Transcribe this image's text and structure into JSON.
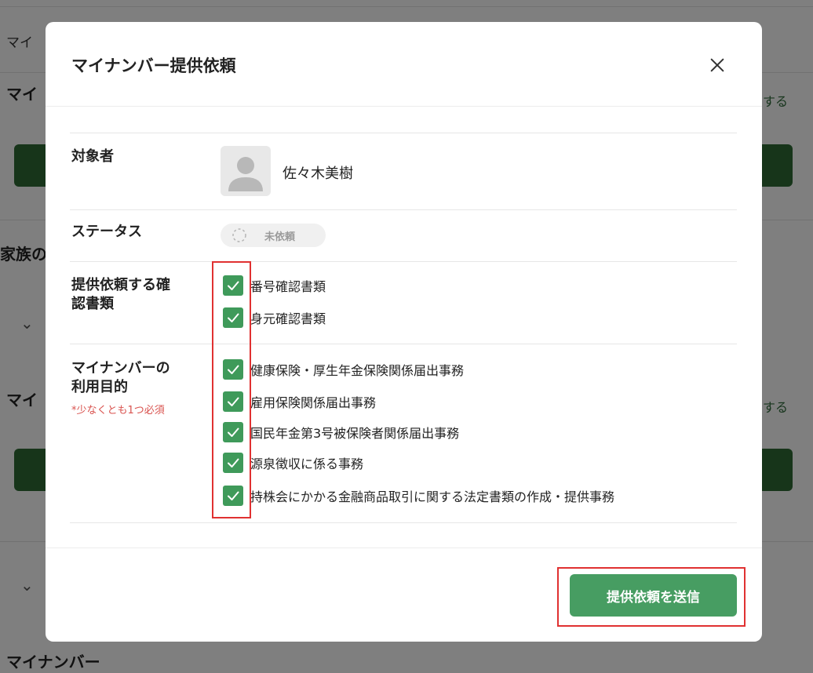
{
  "background": {
    "row1_label": "マイ",
    "row2_label": "マイ",
    "family_heading": "家族の",
    "row3_label": "マイ",
    "bottom_label": "マイナンバー",
    "link_text": "する",
    "link_text_2": "する"
  },
  "modal": {
    "title": "マイナンバー提供依頼",
    "close_icon": "close-icon",
    "target_label": "対象者",
    "target_name": "佐々木美樹",
    "status_label": "ステータス",
    "status_value": "未依頼",
    "documents_label_line1": "提供依頼する確",
    "documents_label_line2": "認書類",
    "documents": [
      {
        "label": "番号確認書類",
        "checked": true
      },
      {
        "label": "身元確認書類",
        "checked": true
      }
    ],
    "purpose_label_line1": "マイナンバーの",
    "purpose_label_line2": "利用目的",
    "purpose_required_note": "*少なくとも1つ必須",
    "purposes": [
      {
        "label": "健康保険・厚生年金保険関係届出事務",
        "checked": true
      },
      {
        "label": "雇用保険関係届出事務",
        "checked": true
      },
      {
        "label": "国民年金第3号被保険者関係届出事務",
        "checked": true
      },
      {
        "label": "源泉徴収に係る事務",
        "checked": true
      },
      {
        "label": "持株会にかかる金融商品取引に関する法定書類の作成・提供事務",
        "checked": true
      }
    ],
    "submit_label": "提供依頼を送信"
  },
  "colors": {
    "accent_green": "#479d62",
    "checkbox_green": "#3f9a5a",
    "highlight_red": "#e03131",
    "required_red": "#d9534f"
  }
}
